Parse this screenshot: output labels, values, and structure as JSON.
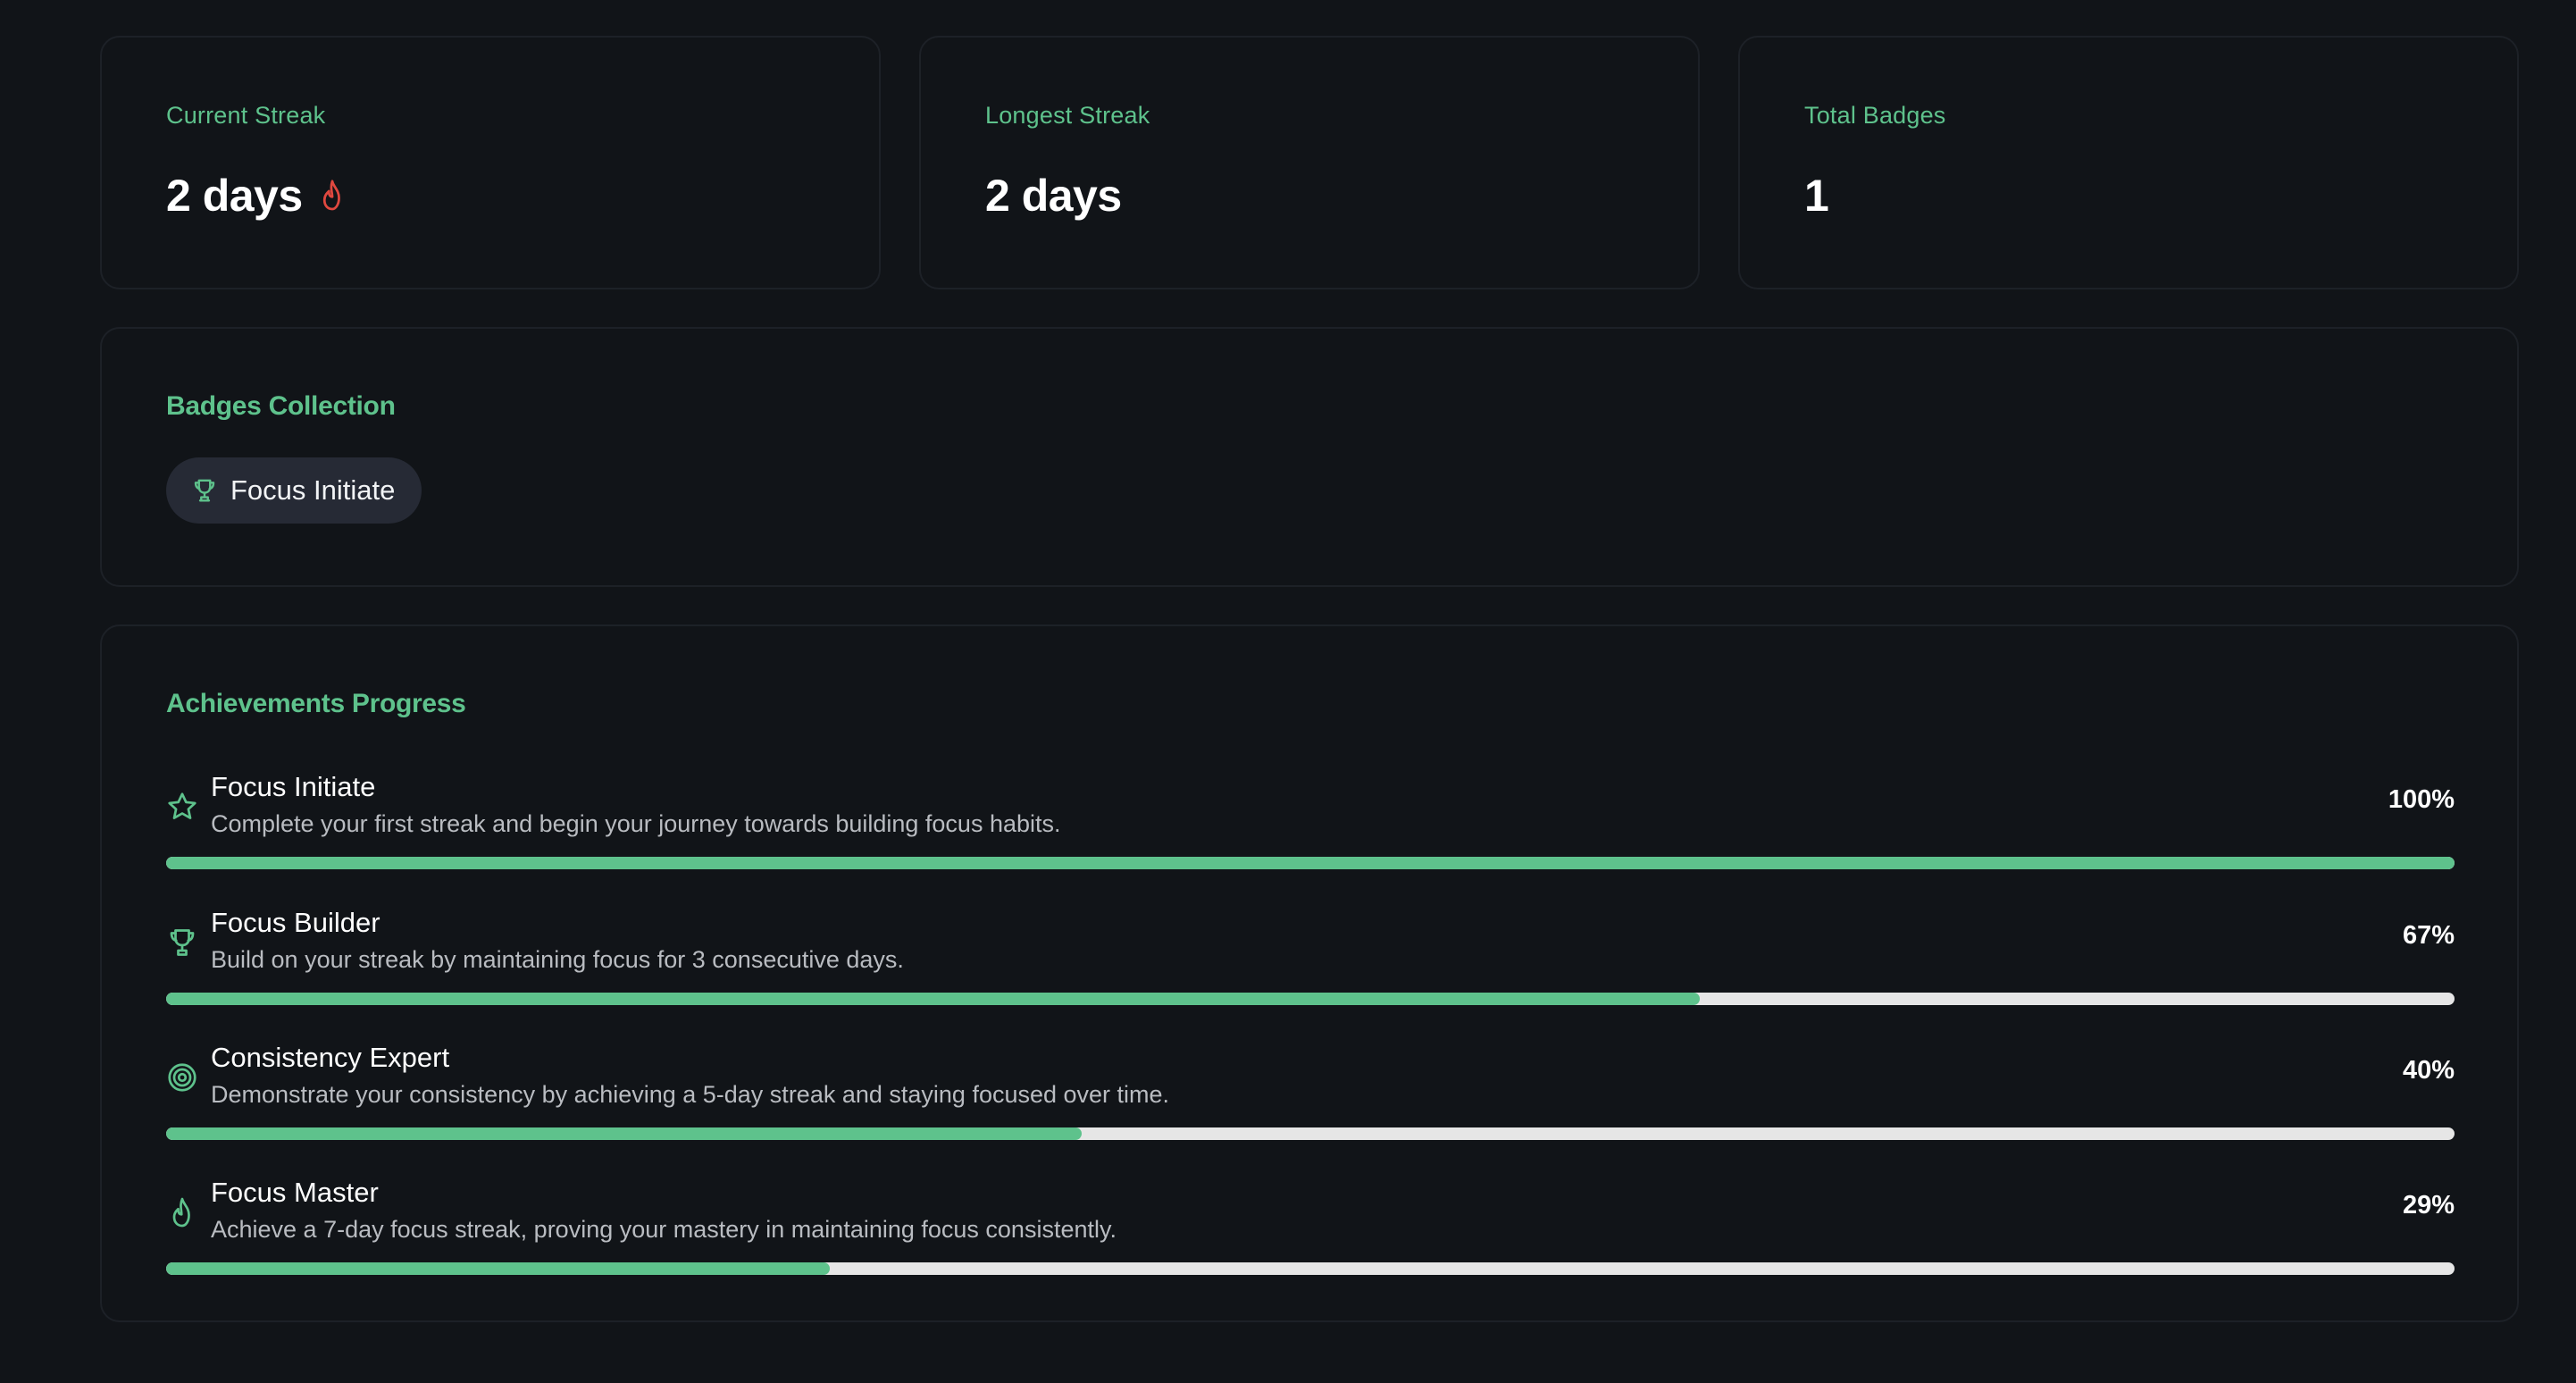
{
  "colors": {
    "background": "#111418",
    "card_border": "#1d2127",
    "accent_green": "#5ec28c",
    "flame_red": "#e0483f",
    "progress_track": "#e6e6e6",
    "chip_background": "#262a35"
  },
  "stats": [
    {
      "label": "Current Streak",
      "value": "2 days",
      "icon": "flame-icon"
    },
    {
      "label": "Longest Streak",
      "value": "2 days"
    },
    {
      "label": "Total Badges",
      "value": "1"
    }
  ],
  "badges_collection": {
    "title": "Badges Collection",
    "badges": [
      {
        "label": "Focus Initiate",
        "icon": "trophy-icon"
      }
    ]
  },
  "achievements": {
    "title": "Achievements Progress",
    "items": [
      {
        "name": "Focus Initiate",
        "description": "Complete your first streak and begin your journey towards building focus habits.",
        "percent_label": "100%",
        "progress": 100,
        "icon": "star-icon"
      },
      {
        "name": "Focus Builder",
        "description": "Build on your streak by maintaining focus for 3 consecutive days.",
        "percent_label": "67%",
        "progress": 67,
        "icon": "trophy-icon"
      },
      {
        "name": "Consistency Expert",
        "description": "Demonstrate your consistency by achieving a 5-day streak and staying focused over time.",
        "percent_label": "40%",
        "progress": 40,
        "icon": "target-icon"
      },
      {
        "name": "Focus Master",
        "description": "Achieve a 7-day focus streak, proving your mastery in maintaining focus consistently.",
        "percent_label": "29%",
        "progress": 29,
        "icon": "flame-icon"
      }
    ]
  }
}
